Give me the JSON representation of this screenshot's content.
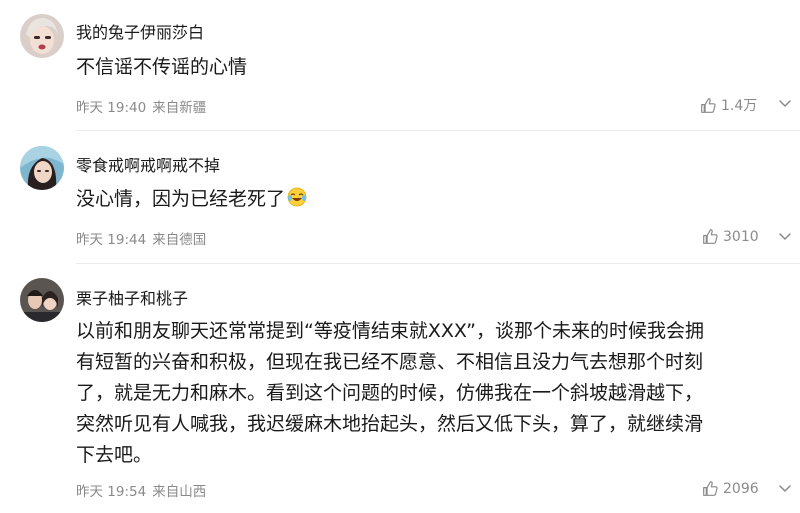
{
  "comments": [
    {
      "username": "我的兔子伊丽莎白",
      "content": "不信谣不传谣的心情",
      "time": "昨天 19:40",
      "location": "来自新疆",
      "likes": "1.4万"
    },
    {
      "username": "零食戒啊戒啊戒不掉",
      "content": "没心情，因为已经老死了",
      "emoji": "laughing-crying-emoji",
      "time": "昨天 19:44",
      "location": "来自德国",
      "likes": "3010"
    },
    {
      "username": "栗子柚子和桃子",
      "content_lines": [
        "以前和朋友聊天还常常提到“等疫情结束就XXX”，谈那个未来的时候我会拥",
        "有短暂的兴奋和积极，但现在我已经不愿意、不相信且没力气去想那个时刻",
        "了，就是无力和麻木。看到这个问题的时候，仿佛我在一个斜坡越滑越下，",
        "突然听见有人喊我，我迟缓麻木地抬起头，然后又低下头，算了，就继续滑",
        "下去吧。"
      ],
      "time": "昨天 19:54",
      "location": "来自山西",
      "likes": "2096"
    }
  ],
  "icons": {
    "like": "thumbs-up-icon",
    "more": "more-icon"
  },
  "colors": {
    "meta_text": "#8a8a8a",
    "divider": "#ececec",
    "text": "#1a1a1a"
  }
}
